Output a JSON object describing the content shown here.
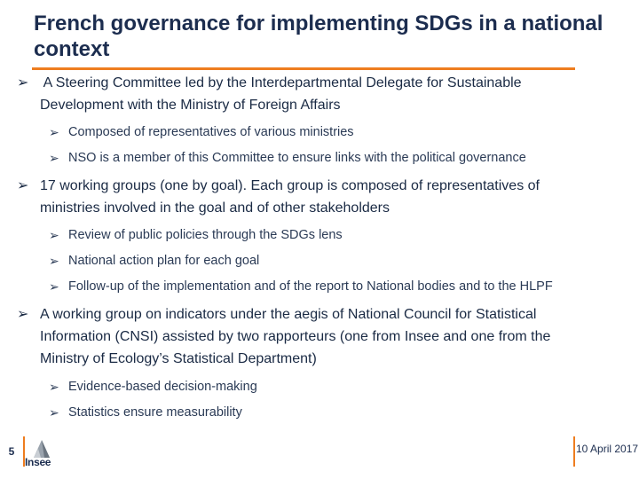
{
  "slide": {
    "title": "French governance for implementing SDGs in a national context",
    "bullets": [
      {
        "text_lines": [
          " A Steering Committee led by the Interdepartmental Delegate for Sustainable",
          "Development with the Ministry of Foreign Affairs"
        ],
        "subs": [
          "Composed of representatives of various ministries",
          "NSO is a member of this Committee to ensure links with the political governance"
        ]
      },
      {
        "text_lines": [
          "17 working groups (one by goal). Each group is composed of representatives of",
          "ministries involved in the goal and of other stakeholders"
        ],
        "subs": [
          "Review of public policies through the SDGs lens",
          "National action plan for each goal",
          "Follow-up of the implementation and of the report to National bodies and to the HLPF"
        ]
      },
      {
        "text_lines": [
          "A working group on indicators under the aegis of National Council for Statistical",
          "Information (CNSI) assisted by two rapporteurs (one from Insee and one from the",
          "Ministry of Ecology’s Statistical Department)"
        ],
        "subs": [
          "Evidence-based decision-making",
          "Statistics ensure measurability"
        ]
      }
    ]
  },
  "footer": {
    "page_number": "5",
    "logo_text": "Insee",
    "date": "10 April 2017"
  },
  "colors": {
    "accent": "#ee7d1f",
    "title": "#1c2d4f",
    "text": "#1a2a44"
  },
  "icons": {
    "bullet": "arrow-bullet-icon"
  }
}
